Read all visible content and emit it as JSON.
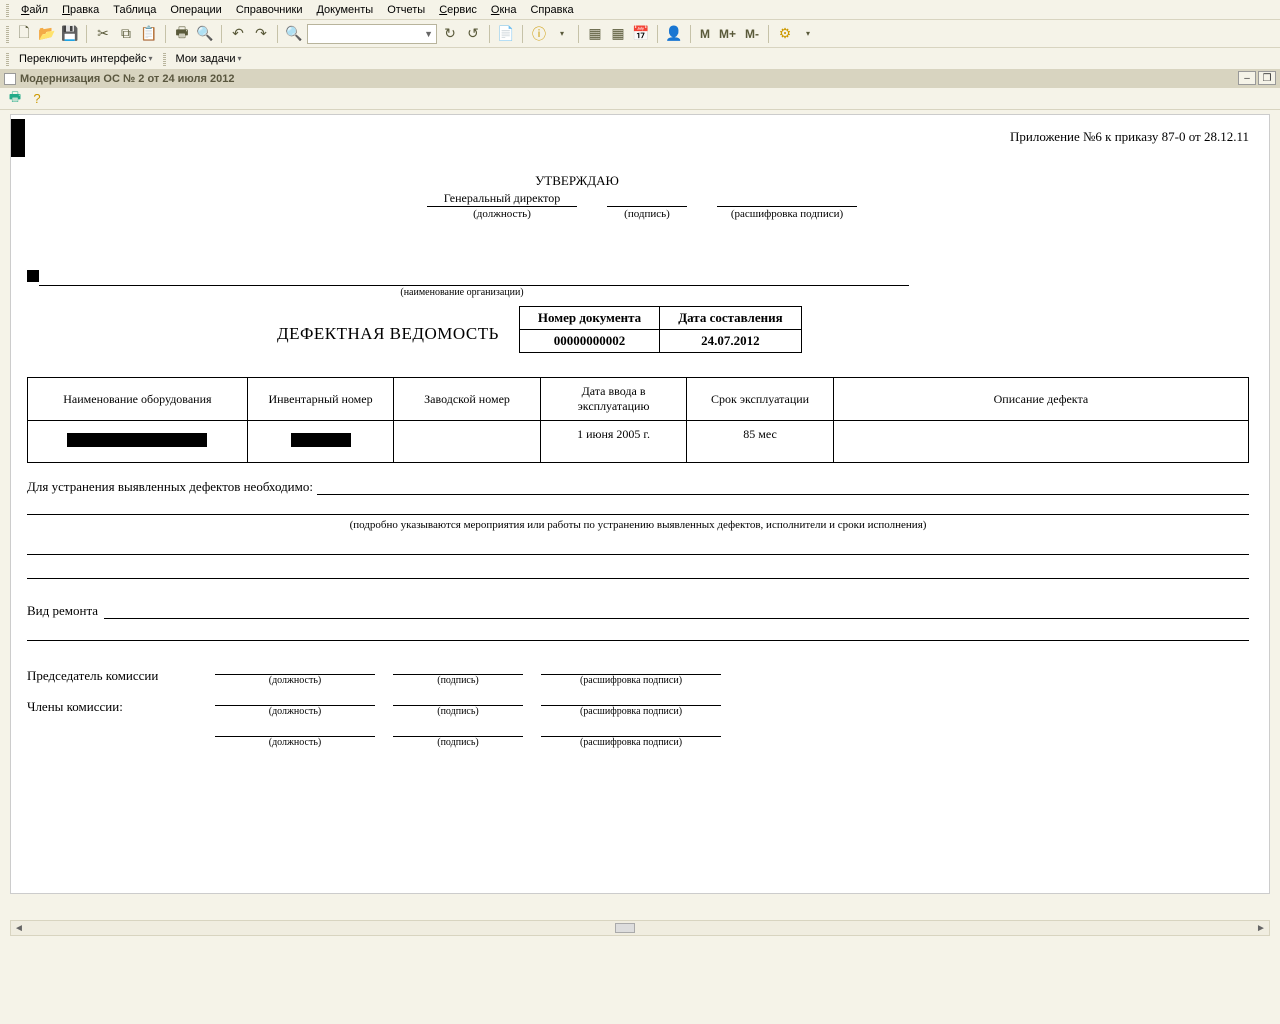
{
  "menu": {
    "file": "Файл",
    "edit": "Правка",
    "table": "Таблица",
    "operations": "Операции",
    "refs": "Справочники",
    "docs": "Документы",
    "reports": "Отчеты",
    "service": "Сервис",
    "windows": "Окна",
    "help": "Справка"
  },
  "secbar": {
    "switch": "Переключить интерфейс",
    "tasks": "Мои задачи"
  },
  "doc": {
    "title": "Модернизация ОС № 2 от 24 июля 2012"
  },
  "tb_text": {
    "m": "M",
    "mp": "M+",
    "mm": "M-"
  },
  "page": {
    "appendix": "Приложение №6 к приказу 87-0 от 28.12.11",
    "approve": "УТВЕРЖДАЮ",
    "gen_dir": "Генеральный директор",
    "position": "(должность)",
    "signature": "(подпись)",
    "decipher": "(расшифровка подписи)",
    "org_caption": "(наименование организации)",
    "main_title": "ДЕФЕКТНАЯ ВЕДОМОСТЬ",
    "doc_num_h": "Номер документа",
    "doc_date_h": "Дата составления",
    "doc_num": "00000000002",
    "doc_date": "24.07.2012",
    "cols": {
      "name": "Наименование оборудования",
      "inv": "Инвентарный номер",
      "factory": "Заводской номер",
      "commiss": "Дата ввода в эксплуатацию",
      "life": "Срок эксплуатации",
      "defect": "Описание дефекта"
    },
    "row": {
      "commiss": "1 июня 2005 г.",
      "life": "85 мес"
    },
    "remedy_label": "Для устранения выявленных дефектов необходимо:",
    "remedy_caption": "(подробно указываются мероприятия или работы по устранению выявленных дефектов, исполнители и сроки исполнения)",
    "repair_label": "Вид ремонта",
    "chair": "Председатель комиссии",
    "members": "Члены комиссии:",
    "sub_pos": "(должность)",
    "sub_sig": "(подпись)",
    "sub_dec": "(расшифровка подписи)"
  }
}
